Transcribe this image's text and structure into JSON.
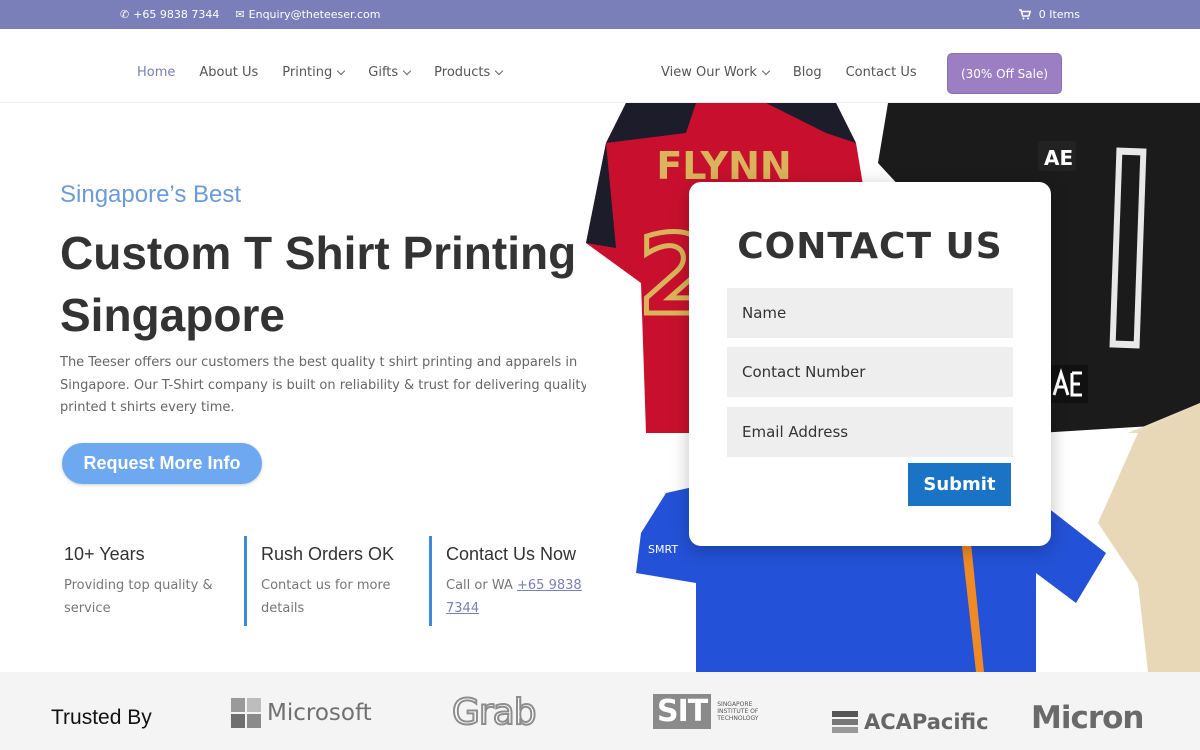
{
  "topbar": {
    "phone": "+65 9838 7344",
    "email": "Enquiry@theteeser.com",
    "cart": "0 Items"
  },
  "nav": {
    "left": [
      {
        "label": "Home",
        "dropdown": false,
        "active": true
      },
      {
        "label": "About Us",
        "dropdown": false
      },
      {
        "label": "Printing",
        "dropdown": true
      },
      {
        "label": "Gifts",
        "dropdown": true
      },
      {
        "label": "Products",
        "dropdown": true
      }
    ],
    "right": [
      {
        "label": "View Our Work",
        "dropdown": true
      },
      {
        "label": "Blog",
        "dropdown": false
      },
      {
        "label": "Contact Us",
        "dropdown": false
      }
    ],
    "sale_button": "(30% Off Sale)"
  },
  "hero": {
    "subtitle": "Singapore’s Best",
    "title": "Custom T Shirt Printing Singapore",
    "description": "The Teeser offers our customers the best quality t shirt printing and apparels in Singapore. Our T-Shirt company is built on reliability & trust for delivering quality printed t shirts every time.",
    "cta": "Request More Info"
  },
  "features": [
    {
      "title": "10+ Years",
      "desc": "Providing top quality & service"
    },
    {
      "title": "Rush Orders OK",
      "desc": "Contact us for more details"
    },
    {
      "title": "Contact Us Now",
      "desc_prefix": "Call or WA ",
      "desc_link": "+65 9838 7344"
    }
  ],
  "shirts": {
    "jersey_name": "FLYNN",
    "jersey_number": "2",
    "black_logo": "AE",
    "blue_text": "SMRT"
  },
  "contact_form": {
    "title": "CONTACT US",
    "name_placeholder": "Name",
    "phone_placeholder": "Contact Number",
    "email_placeholder": "Email Address",
    "submit": "Submit"
  },
  "trusted": {
    "label": "Trusted By",
    "logos": [
      "Microsoft",
      "Grab",
      "SIT",
      "ACAPacific",
      "Micron"
    ],
    "sit_line1": "SINGAPORE",
    "sit_line2": "INSTITUTE OF",
    "sit_line3": "TECHNOLOGY"
  },
  "colors": {
    "topbar": "#7a7fb9",
    "sale": "#9b7fc2",
    "accent": "#6b9bd8",
    "cta": "#6ea8f0",
    "submit": "#1a73c5",
    "feature_border": "#3a8ad8"
  }
}
